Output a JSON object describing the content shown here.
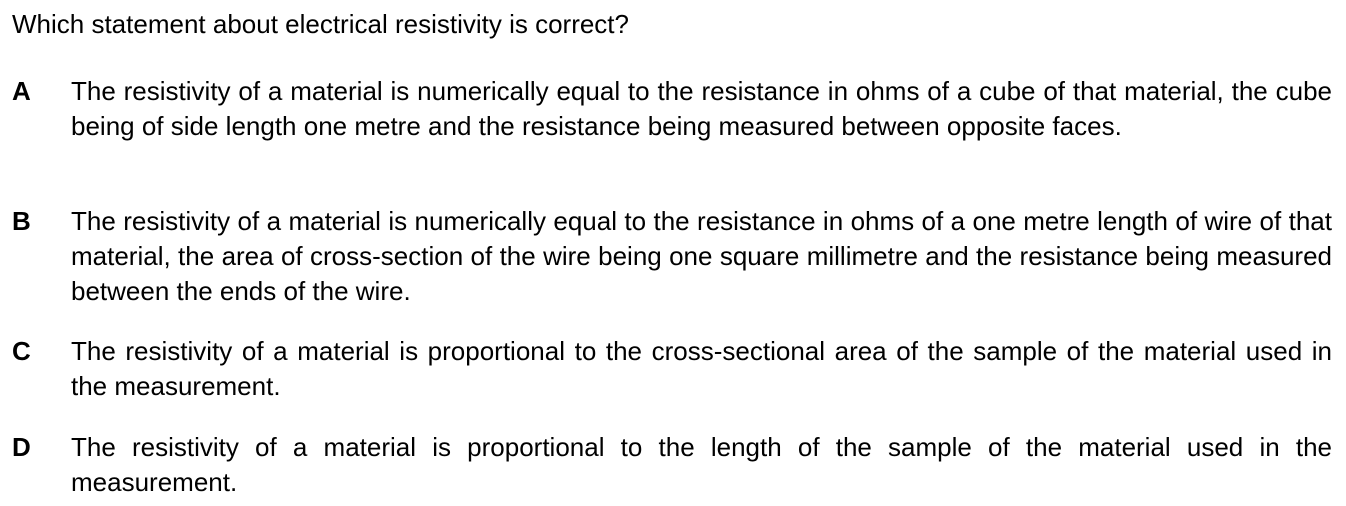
{
  "question": {
    "text": "Which statement about electrical resistivity is correct?"
  },
  "options": [
    {
      "letter": "A",
      "text": "The resistivity of a material is numerically equal to the resistance in ohms of a cube of that material, the cube being of side length one metre and the resistance being measured between opposite faces."
    },
    {
      "letter": "B",
      "text": "The resistivity of a material is numerically equal to the resistance in ohms of a one metre length of wire of that material, the area of cross-section of the wire being one square millimetre and the resistance being measured between the ends of the wire."
    },
    {
      "letter": "C",
      "text": "The resistivity of a material is proportional to the cross-sectional area of the sample of the material used in the measurement."
    },
    {
      "letter": "D",
      "text": "The resistivity of a material is proportional to the length of the sample of the material used in the measurement."
    }
  ]
}
